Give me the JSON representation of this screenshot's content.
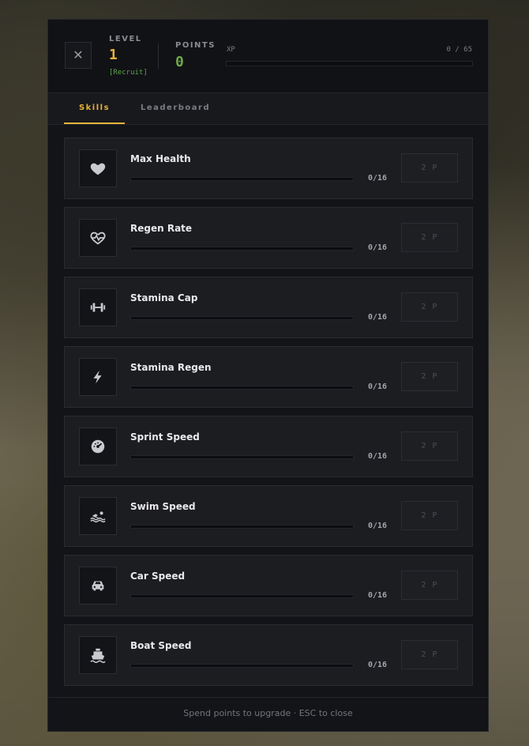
{
  "header": {
    "close_label": "✕",
    "level_label": "LEVEL",
    "level_value": "1",
    "level_rank": "[Recruit]",
    "points_label": "POINTS",
    "points_value": "0",
    "xp_label": "XP",
    "xp_value": "0 / 65",
    "xp_progress": 0
  },
  "tabs": [
    {
      "label": "Skills",
      "active": true
    },
    {
      "label": "Leaderboard",
      "active": false
    }
  ],
  "skills": [
    {
      "name": "Max Health",
      "icon": "heart-icon",
      "count": "0/16",
      "progress": 0,
      "cost": "2 P"
    },
    {
      "name": "Regen Rate",
      "icon": "heartbeat-icon",
      "count": "0/16",
      "progress": 0,
      "cost": "2 P"
    },
    {
      "name": "Stamina Cap",
      "icon": "dumbbell-icon",
      "count": "0/16",
      "progress": 0,
      "cost": "2 P"
    },
    {
      "name": "Stamina Regen",
      "icon": "lightning-icon",
      "count": "0/16",
      "progress": 0,
      "cost": "2 P"
    },
    {
      "name": "Sprint Speed",
      "icon": "speedometer-icon",
      "count": "0/16",
      "progress": 0,
      "cost": "2 P"
    },
    {
      "name": "Swim Speed",
      "icon": "swimmer-icon",
      "count": "0/16",
      "progress": 0,
      "cost": "2 P"
    },
    {
      "name": "Car Speed",
      "icon": "car-icon",
      "count": "0/16",
      "progress": 0,
      "cost": "2 P"
    },
    {
      "name": "Boat Speed",
      "icon": "boat-icon",
      "count": "0/16",
      "progress": 0,
      "cost": "2 P"
    }
  ],
  "footer": {
    "hint": "Spend points to upgrade · ESC to close"
  },
  "colors": {
    "accent": "#e6b23a",
    "points": "#6ea84a",
    "rank": "#58a64a"
  }
}
